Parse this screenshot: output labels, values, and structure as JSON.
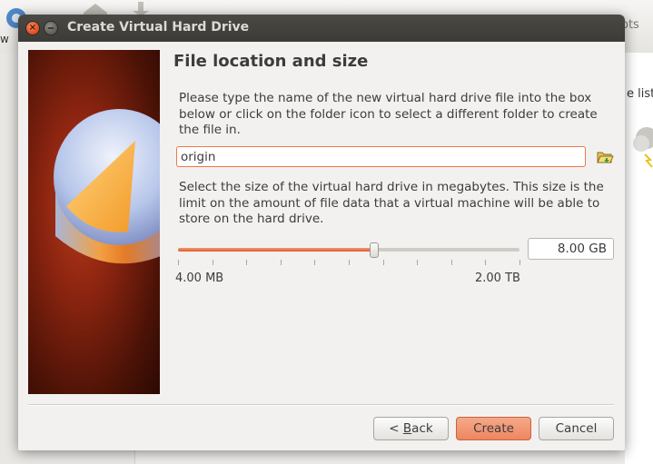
{
  "window": {
    "title": "Create Virtual Hard Drive",
    "close_glyph": "×"
  },
  "background": {
    "new_label": "w",
    "snapshots_label": "ots",
    "list_text": "e list i"
  },
  "page": {
    "heading": "File location and size",
    "file_instructions": "Please type the name of the new virtual hard drive file into the box below or click on the folder icon to select a different folder to create the file in.",
    "file_name_value": "origin",
    "size_instructions": "Select the size of the virtual hard drive in megabytes. This size is the limit on the amount of file data that a virtual machine will be able to store on the hard drive.",
    "size_value": "8.00 GB",
    "slider_fraction": 0.575,
    "slider_min_label": "4.00 MB",
    "slider_max_label": "2.00 TB"
  },
  "buttons": {
    "back_prefix": "< ",
    "back_mnemonic": "B",
    "back_rest": "ack",
    "create": "Create",
    "cancel": "Cancel"
  },
  "icons": {
    "close": "close-icon",
    "minimize": "minimize-icon",
    "folder": "folder-open-icon",
    "wizard_art": "hard-disk-illustration"
  },
  "colors": {
    "accent": "#e0592a",
    "create_button": "#ee8660",
    "titlebar": "#3c3b37",
    "input_focus_border": "#f07746"
  }
}
